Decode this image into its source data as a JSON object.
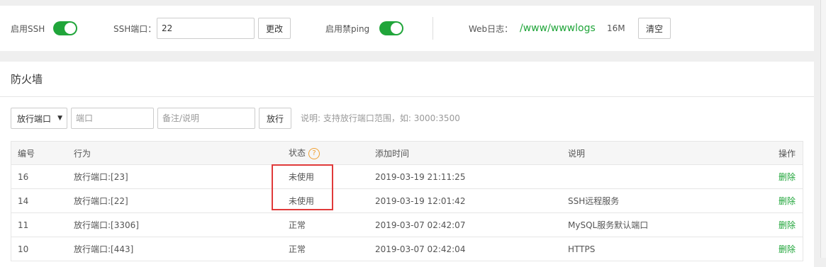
{
  "settings": {
    "ssh_enable_label": "启用SSH",
    "ssh_port_label": "SSH端口：",
    "ssh_port_value": "22",
    "change_button": "更改",
    "disable_ping_label": "启用禁ping",
    "web_log_label": "Web日志：",
    "web_log_path": "/www/wwwlogs",
    "web_log_size": "16M",
    "clear_button": "清空",
    "ssh_enabled": true,
    "disable_ping_enabled": true
  },
  "firewall": {
    "title": "防火墙",
    "action_select": "放行端口",
    "port_placeholder": "端口",
    "note_placeholder": "备注/说明",
    "allow_button": "放行",
    "hint": "说明: 支持放行端口范围，如: 3000:3500",
    "table": {
      "headers": [
        "编号",
        "行为",
        "状态",
        "添加时间",
        "说明",
        "操作"
      ],
      "rows": [
        {
          "id": "16",
          "action": "放行端口:[23]",
          "status": "未使用",
          "time": "2019-03-19 21:11:25",
          "note": "",
          "op": "删除"
        },
        {
          "id": "14",
          "action": "放行端口:[22]",
          "status": "未使用",
          "time": "2019-03-19 12:01:42",
          "note": "SSH远程服务",
          "op": "删除"
        },
        {
          "id": "11",
          "action": "放行端口:[3306]",
          "status": "正常",
          "time": "2019-03-07 02:42:07",
          "note": "MySQL服务默认端口",
          "op": "删除"
        },
        {
          "id": "10",
          "action": "放行端口:[443]",
          "status": "正常",
          "time": "2019-03-07 02:42:04",
          "note": "HTTPS",
          "op": "删除"
        }
      ]
    }
  },
  "colors": {
    "accent_green": "#20a53a",
    "highlight_red": "#e03a3a",
    "help_orange": "#f0a033"
  }
}
